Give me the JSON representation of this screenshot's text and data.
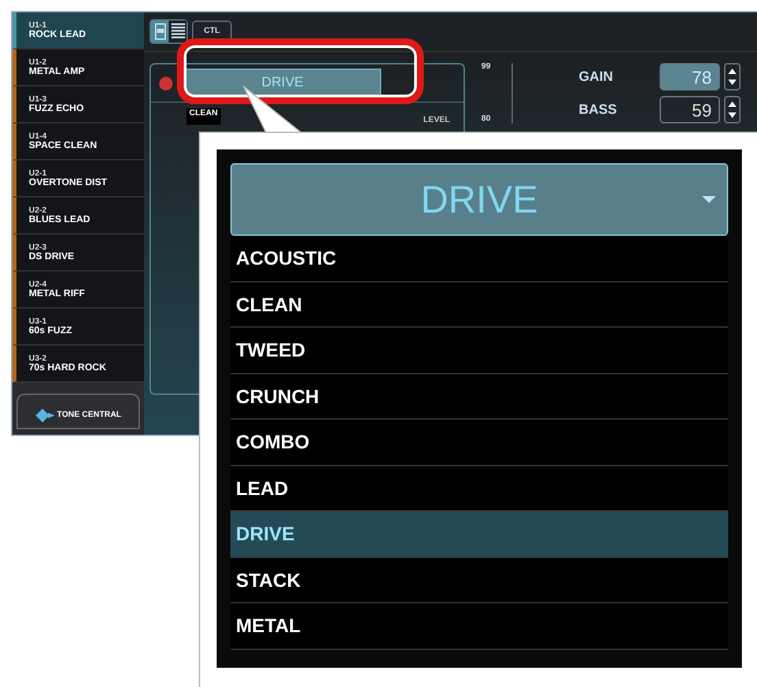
{
  "presets": [
    {
      "number": "U1-1",
      "name": "ROCK LEAD",
      "selected": true
    },
    {
      "number": "U1-2",
      "name": "METAL AMP",
      "selected": false
    },
    {
      "number": "U1-3",
      "name": "FUZZ ECHO",
      "selected": false
    },
    {
      "number": "U1-4",
      "name": "SPACE CLEAN",
      "selected": false
    },
    {
      "number": "U2-1",
      "name": "OVERTONE DIST",
      "selected": false
    },
    {
      "number": "U2-2",
      "name": "BLUES LEAD",
      "selected": false
    },
    {
      "number": "U2-3",
      "name": "DS DRIVE",
      "selected": false
    },
    {
      "number": "U2-4",
      "name": "METAL RIFF",
      "selected": false
    },
    {
      "number": "U3-1",
      "name": "60s FUZZ",
      "selected": false
    },
    {
      "number": "U3-2",
      "name": "70s HARD ROCK",
      "selected": false
    }
  ],
  "tone_central": {
    "label": "TONE CENTRAL"
  },
  "toolbar": {
    "ctl_label": "CTL"
  },
  "amp": {
    "type": "DRIVE",
    "list_first": "CLEAN",
    "level_label": "LEVEL",
    "scale": [
      "99",
      "80"
    ],
    "knobs": [
      {
        "label": "GAIN",
        "value": "78",
        "selected": true
      },
      {
        "label": "BASS",
        "value": "59",
        "selected": false
      }
    ]
  },
  "callout": {
    "type": "DRIVE",
    "options": [
      {
        "label": "ACOUSTIC",
        "selected": false
      },
      {
        "label": "CLEAN",
        "selected": false
      },
      {
        "label": "TWEED",
        "selected": false
      },
      {
        "label": "CRUNCH",
        "selected": false
      },
      {
        "label": "COMBO",
        "selected": false
      },
      {
        "label": "LEAD",
        "selected": false
      },
      {
        "label": "DRIVE",
        "selected": true
      },
      {
        "label": "STACK",
        "selected": false
      },
      {
        "label": "METAL",
        "selected": false
      }
    ]
  }
}
